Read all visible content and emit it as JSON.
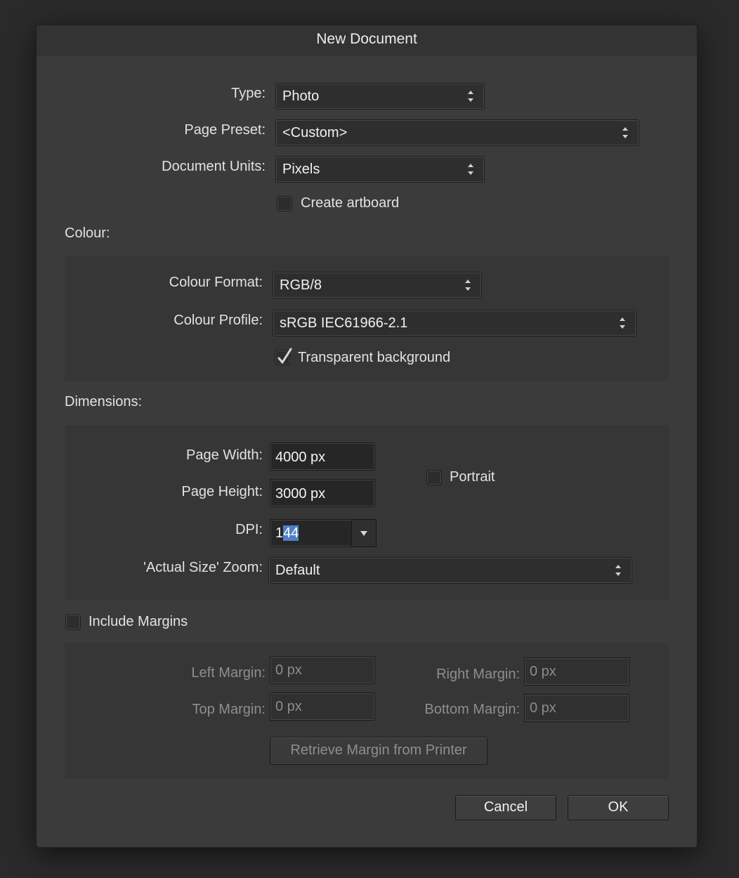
{
  "dialog": {
    "title": "New Document",
    "type_label": "Type:",
    "type_value": "Photo",
    "preset_label": "Page Preset:",
    "preset_value": "<Custom>",
    "units_label": "Document Units:",
    "units_value": "Pixels",
    "artboard_label": "Create artboard",
    "artboard_checked": false
  },
  "colour": {
    "section_label": "Colour:",
    "format_label": "Colour Format:",
    "format_value": "RGB/8",
    "profile_label": "Colour Profile:",
    "profile_value": "sRGB IEC61966-2.1",
    "transparent_label": "Transparent background",
    "transparent_checked": true
  },
  "dimensions": {
    "section_label": "Dimensions:",
    "width_label": "Page Width:",
    "width_value": "4000 px",
    "height_label": "Page Height:",
    "height_value": "3000 px",
    "portrait_label": "Portrait",
    "portrait_checked": false,
    "dpi_label": "DPI:",
    "dpi_value_prefix": "1",
    "dpi_value_selected": "44",
    "zoom_label": "'Actual Size' Zoom:",
    "zoom_value": "Default"
  },
  "margins": {
    "include_label": "Include Margins",
    "include_checked": false,
    "left_label": "Left Margin:",
    "left_value": "0 px",
    "right_label": "Right Margin:",
    "right_value": "0 px",
    "top_label": "Top Margin:",
    "top_value": "0 px",
    "bottom_label": "Bottom Margin:",
    "bottom_value": "0 px",
    "retrieve_label": "Retrieve Margin from Printer"
  },
  "buttons": {
    "cancel": "Cancel",
    "ok": "OK"
  },
  "colors": {
    "selection_highlight": "#4f7fc4",
    "dialog_bg": "#3b3b3b",
    "panel_bg": "#363636"
  }
}
